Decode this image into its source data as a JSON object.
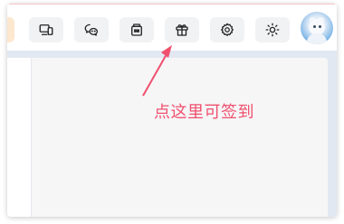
{
  "toolbar": {
    "buttons": [
      {
        "name": "partial-button",
        "icon": "unknown-icon"
      },
      {
        "name": "devices-button",
        "icon": "devices-icon"
      },
      {
        "name": "wechat-button",
        "icon": "wechat-icon"
      },
      {
        "name": "store-button",
        "icon": "store-icon"
      },
      {
        "name": "gift-button",
        "icon": "gift-icon"
      },
      {
        "name": "settings-button",
        "icon": "gear-icon"
      },
      {
        "name": "theme-button",
        "icon": "sun-icon"
      }
    ],
    "avatar": "avatar-cat"
  },
  "annotation": {
    "hint_text": "点这里可签到",
    "color": "#f0506e"
  },
  "colors": {
    "accent": "#f0506e",
    "button_bg": "#f1f2f4",
    "content_bg": "#e2e8f2",
    "panel_bg": "#f6f6f7"
  }
}
